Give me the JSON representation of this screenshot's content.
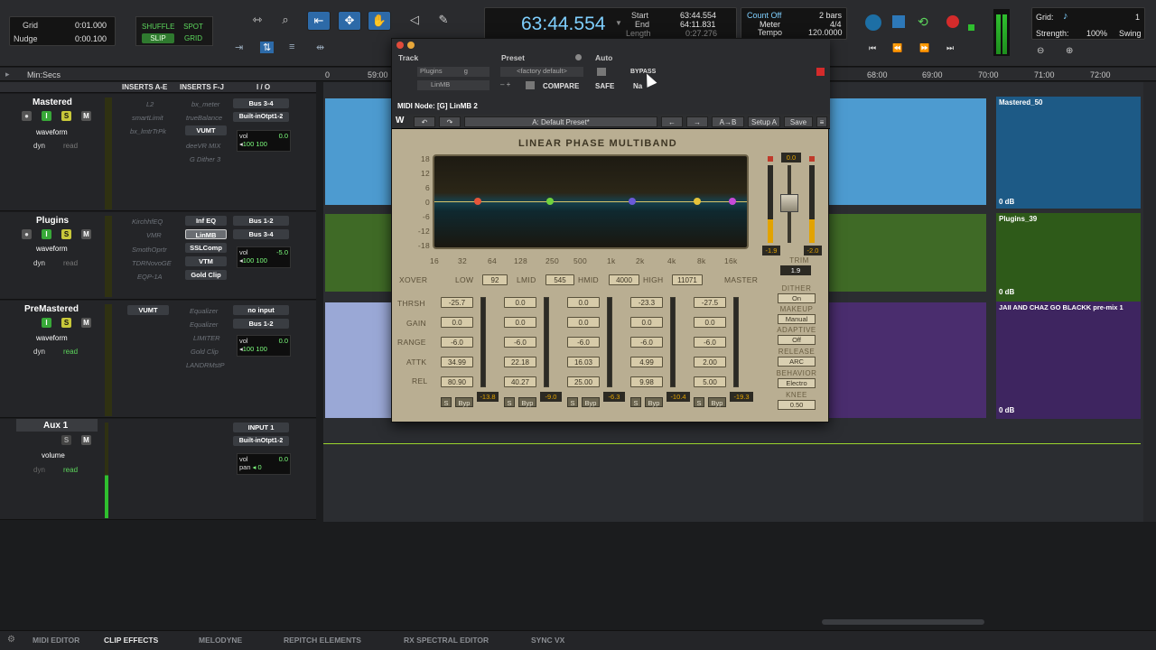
{
  "toolbar": {
    "grid_label": "Grid",
    "grid_value": "0:01.000",
    "nudge_label": "Nudge",
    "nudge_value": "0:00.100",
    "modes": [
      "SHUFFLE",
      "SPOT",
      "SLIP",
      "GRID"
    ],
    "main_counter": "63:44.554",
    "start_label": "Start",
    "start_value": "63:44.554",
    "end_label": "End",
    "end_value": "64:11.831",
    "length_label": "Length",
    "length_value": "0:27.276",
    "count_off": "Count Off",
    "bars": "2 bars",
    "meter_label": "Meter",
    "meter_value": "4/4",
    "tempo_label": "Tempo",
    "tempo_value": "120.0000",
    "grid2_label": "Grid:",
    "grid2_value": "1",
    "strength_label": "Strength:",
    "strength_value": "100%",
    "swing_label": "Swing"
  },
  "ruler": {
    "label": "Min:Secs",
    "ticks": [
      "59:00",
      "68:00",
      "69:00",
      "70:00",
      "71:00",
      "72:00"
    ],
    "tick_left": "0"
  },
  "mix_headers": {
    "inserts_ae": "INSERTS A-E",
    "inserts_fj": "INSERTS F-J",
    "io": "I / O"
  },
  "tracks": [
    {
      "name": "Mastered",
      "view": "waveform",
      "dyn": "dyn",
      "mode": "read",
      "inserts_ae": [
        "L2",
        "smartLimit",
        "bx_lmtrTrPk"
      ],
      "inserts_fj": [
        "bx_meter",
        "trueBalance",
        "VUMT",
        "deeVR MIX",
        "G Dither 3"
      ],
      "io_out": "Bus 3-4",
      "io_in": "Built-inOtpt1-2",
      "vol": "0.0",
      "pan": [
        "100",
        "100"
      ],
      "clip_name": "Mastered_50",
      "clip_gain": "0 dB"
    },
    {
      "name": "Plugins",
      "view": "waveform",
      "dyn": "dyn",
      "mode": "read",
      "inserts_ae": [
        "KirchhfEQ",
        "VMR",
        "SmothOprtr",
        "TDRNovoGE",
        "EQP-1A"
      ],
      "inserts_fj": [
        "Inf EQ",
        "LinMB",
        "SSLComp",
        "VTM",
        "Gold Clip"
      ],
      "io_out": "Bus 1-2",
      "io_in": "Bus 3-4",
      "vol": "-5.0",
      "pan": [
        "100",
        "100"
      ],
      "clip_name": "Plugins_39",
      "clip_gain": "0 dB"
    },
    {
      "name": "PreMastered",
      "view": "waveform",
      "dyn": "dyn",
      "mode": "read",
      "inserts_ae": [
        "VUMT"
      ],
      "inserts_fj": [
        "Equalizer",
        "Equalizer",
        "LIMITER",
        "Gold Clip",
        "LANDRMstP"
      ],
      "io_out": "no input",
      "io_in": "Bus 1-2",
      "vol": "0.0",
      "pan": [
        "100",
        "100"
      ],
      "clip_name": "JAII AND CHAZ GO BLACKK pre-mix 1",
      "clip_gain": "0 dB"
    },
    {
      "name": "Aux 1",
      "view": "volume",
      "dyn": "dyn",
      "mode": "read",
      "inserts_ae": [],
      "inserts_fj": [],
      "io_out": "INPUT 1",
      "io_in": "Built-inOtpt1-2",
      "vol": "0.0",
      "pan_label": "pan",
      "pan": [
        "0"
      ],
      "clip_name": "",
      "clip_gain": ""
    }
  ],
  "plugin": {
    "track_label": "Track",
    "preset_label": "Preset",
    "auto_label": "Auto",
    "track_value": "Plugins",
    "track_sub": "g",
    "insert_value": "LinMB",
    "preset_value": "<factory default>",
    "bypass_label": "BYPASS",
    "compare_label": "COMPARE",
    "safe_label": "SAFE",
    "native_label": "Na",
    "midi_node": "MIDI Node: [G] LinMB 2",
    "waves_preset": "A: Default Preset*",
    "ab_label": "A→B",
    "setup_label": "Setup A",
    "save_label": "Save",
    "title": "LINEAR PHASE MULTIBAND",
    "db_scale": [
      "18",
      "12",
      "6",
      "0",
      "-6",
      "-12",
      "-18"
    ],
    "freq_scale": [
      "16",
      "32",
      "64",
      "128",
      "250",
      "500",
      "1k",
      "2k",
      "4k",
      "8k",
      "16k"
    ],
    "xover_label": "XOVER",
    "band_names": [
      "LOW",
      "LMID",
      "HMID",
      "HIGH",
      "MASTER"
    ],
    "xover_values": [
      "92",
      "545",
      "4000",
      "11071"
    ],
    "row_labels": [
      "THRSH",
      "GAIN",
      "RANGE",
      "ATTK",
      "REL"
    ],
    "bands": [
      {
        "thrsh": "-25.7",
        "gain": "0.0",
        "range": "-6.0",
        "attk": "34.99",
        "rel": "80.90",
        "meter": "-13.8"
      },
      {
        "thrsh": "0.0",
        "gain": "0.0",
        "range": "-6.0",
        "attk": "22.18",
        "rel": "40.27",
        "meter": "-9.0"
      },
      {
        "thrsh": "0.0",
        "gain": "0.0",
        "range": "-6.0",
        "attk": "16.03",
        "rel": "25.00",
        "meter": "-6.3"
      },
      {
        "thrsh": "-23.3",
        "gain": "0.0",
        "range": "-6.0",
        "attk": "4.99",
        "rel": "9.98",
        "meter": "-10.4"
      },
      {
        "thrsh": "-27.5",
        "gain": "0.0",
        "range": "-6.0",
        "attk": "2.00",
        "rel": "5.00",
        "meter": "-19.3"
      }
    ],
    "s_label": "S",
    "byp_label": "Byp",
    "master_gain": "0.0",
    "out_left": "-1.9",
    "out_right": "-2.0",
    "trim_label": "TRIM",
    "trim_value": "1.9",
    "dither_label": "DITHER",
    "dither_value": "On",
    "makeup_label": "MAKEUP",
    "makeup_value": "Manual",
    "adaptive_label": "ADAPTIVE",
    "adaptive_value": "Off",
    "release_label": "RELEASE",
    "release_value": "ARC",
    "behavior_label": "BEHAVIOR",
    "behavior_value": "Electro",
    "knee_label": "KNEE",
    "knee_value": "0.50"
  },
  "bottom_tabs": [
    "MIDI EDITOR",
    "CLIP EFFECTS",
    "MELODYNE",
    "REPITCH ELEMENTS",
    "RX SPECTRAL EDITOR",
    "SYNC VX"
  ],
  "colors": {
    "accent_blue": "#2d6aa8",
    "clip_blue": "#4d9bd0",
    "clip_green": "#3f6a26",
    "clip_purple": "#4a2d6e",
    "record_red": "#d42b2b",
    "plugin_panel": "#b9ae92"
  }
}
